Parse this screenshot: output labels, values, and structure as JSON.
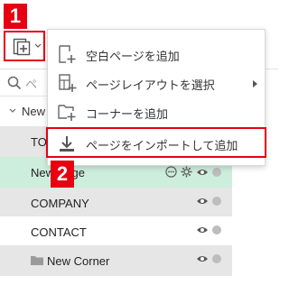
{
  "badges": {
    "step1": "1",
    "step2": "2"
  },
  "search": {
    "placeholder": "ペ"
  },
  "tree": {
    "header_label": "New",
    "rows": [
      {
        "label": "TO",
        "bg": "#e6e6e6"
      },
      {
        "label": "New Page",
        "bg": "#cdeedd"
      },
      {
        "label": "COMPANY",
        "bg": "#e6e6e6"
      },
      {
        "label": "CONTACT",
        "bg": "#ffffff"
      },
      {
        "label": "New Corner",
        "bg": "#e6e6e6"
      }
    ]
  },
  "menu": {
    "items": [
      {
        "label": "空白ページを追加",
        "icon": "blank-page-add-icon"
      },
      {
        "label": "ページレイアウトを選択",
        "icon": "layout-add-icon",
        "has_submenu": true
      },
      {
        "label": "コーナーを追加",
        "icon": "folder-add-icon"
      },
      {
        "label": "ページをインポートして追加",
        "icon": "import-icon",
        "highlighted": true
      }
    ]
  },
  "colors": {
    "accent": "#e60012",
    "selected_row": "#cdeedd",
    "row_gray": "#e6e6e6"
  }
}
